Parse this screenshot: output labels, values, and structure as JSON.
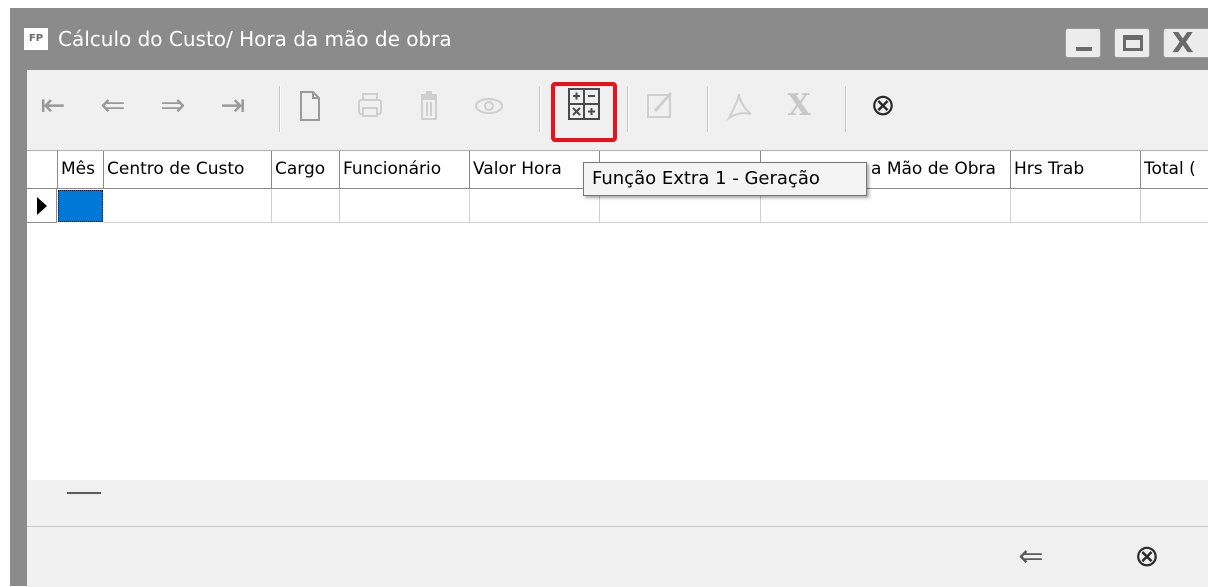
{
  "window": {
    "app_icon_text": "FP",
    "title": "Cálculo do Custo/ Hora da mão de obra"
  },
  "toolbar": {
    "first_icon": "⇤",
    "prev_icon": "⇐",
    "next_icon": "⇒",
    "last_icon": "⇥",
    "close_icon": "⊗",
    "calc_icon_label": "calculator-icon"
  },
  "grid": {
    "columns": [
      {
        "label": "Mês"
      },
      {
        "label": "Centro de Custo"
      },
      {
        "label": "Cargo"
      },
      {
        "label": "Funcionário"
      },
      {
        "label": "Valor Hora"
      },
      {
        "label": ""
      },
      {
        "label": "a Mão de Obra"
      },
      {
        "label": "Hrs Trab"
      },
      {
        "label": "Total ("
      }
    ]
  },
  "tooltip": {
    "text": "Função Extra 1 - Geração"
  },
  "bottom": {
    "back_icon": "⇐",
    "cancel_icon": "⊗"
  }
}
